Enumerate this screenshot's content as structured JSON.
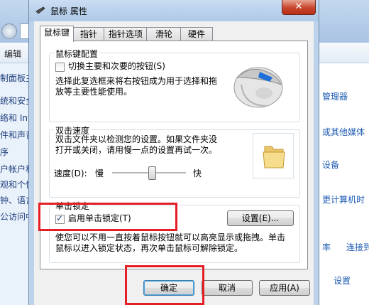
{
  "background": {
    "menu_left": "编辑",
    "left_items": [
      "制面板主",
      "统和安全",
      "络和 Inter",
      "件和声音",
      "序",
      "户帐户和",
      "观和个性",
      "钟、语言",
      "公访问中"
    ],
    "right_links": [
      "管理器",
      "或其他媒体",
      "设备",
      "更计算机时",
      "率",
      "连接到",
      "设置"
    ]
  },
  "dialog": {
    "title": "鼠标 属性",
    "close_symbol": "✕",
    "tabs": [
      "鼠标键",
      "指针",
      "指针选项",
      "滑轮",
      "硬件"
    ],
    "button_config": {
      "group_title": "鼠标键配置",
      "swap_checkbox_label": "切换主要和次要的按钮(S)",
      "description": "选择此复选框来将右按钮成为用于选择和拖放等主要性能使用。"
    },
    "double_click": {
      "group_title": "双击速度",
      "description": "双击文件夹以检测您的设置。如果文件夹没打开或关闭，请用慢一点的设置再试一次。",
      "speed_label": "速度(D):",
      "slow_label": "慢",
      "fast_label": "快",
      "speed_value": 0.55
    },
    "click_lock": {
      "group_title": "单击锁定",
      "checkbox_label": "启用单击锁定(T)",
      "checked": true,
      "settings_button": "设置(E)...",
      "description": "使您可以不用一直按着鼠标按钮就可以高亮显示或拖拽。单击鼠标以进入锁定状态，再次单击鼠标可解除锁定。"
    },
    "buttons": {
      "ok": "确定",
      "cancel": "取消",
      "apply": "应用(A)"
    }
  }
}
